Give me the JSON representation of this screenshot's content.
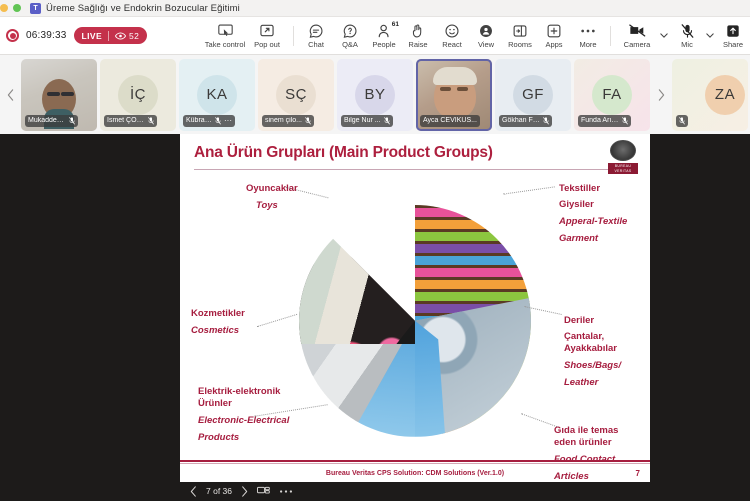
{
  "window": {
    "title": "Üreme Sağlığı ve Endokrin Bozucular Eğitimi",
    "app_icon": "teams-icon"
  },
  "meeting_bar": {
    "recording_icon": "record-icon",
    "timer": "06:39:33",
    "live_label": "LIVE",
    "viewers_icon": "eye-icon",
    "viewers_count": "52"
  },
  "toolbar": {
    "items": [
      {
        "label": "Take control",
        "icon": "take-control-icon",
        "badge": ""
      },
      {
        "label": "Pop out",
        "icon": "pop-out-icon",
        "badge": ""
      },
      {
        "label": "Chat",
        "icon": "chat-icon",
        "badge": ""
      },
      {
        "label": "Q&A",
        "icon": "qa-icon",
        "badge": ""
      },
      {
        "label": "People",
        "icon": "people-icon",
        "badge": "61"
      },
      {
        "label": "Raise",
        "icon": "raise-hand-icon",
        "badge": ""
      },
      {
        "label": "React",
        "icon": "react-smiley-icon",
        "badge": ""
      },
      {
        "label": "View",
        "icon": "view-icon",
        "badge": ""
      },
      {
        "label": "Rooms",
        "icon": "rooms-icon",
        "badge": ""
      },
      {
        "label": "Apps",
        "icon": "apps-plus-icon",
        "badge": ""
      },
      {
        "label": "More",
        "icon": "more-ellipsis-icon",
        "badge": ""
      }
    ],
    "media": [
      {
        "label": "Camera",
        "icon": "camera-off-icon",
        "has_chevron": true
      },
      {
        "label": "Mic",
        "icon": "mic-off-icon",
        "has_chevron": true
      },
      {
        "label": "Share",
        "icon": "share-tray-icon",
        "has_chevron": false
      }
    ]
  },
  "participants": {
    "prev_icon": "chevron-left-icon",
    "next_icon": "chevron-right-icon",
    "tiles": [
      {
        "name": "Mukaddes...",
        "initials": "",
        "type": "video",
        "muted": true,
        "active": false,
        "avatar_bg": "#e9e7e2",
        "more": false
      },
      {
        "name": "İsmet ÇOK...",
        "initials": "İÇ",
        "type": "avatar",
        "muted": true,
        "active": false,
        "avatar_bg": "#dcdcc9",
        "more": false
      },
      {
        "name": "Kübra ...",
        "initials": "KA",
        "type": "avatar",
        "muted": true,
        "active": false,
        "avatar_bg": "#cfe4ea",
        "more": true
      },
      {
        "name": "sinem çilo...",
        "initials": "SÇ",
        "type": "avatar",
        "muted": true,
        "active": false,
        "avatar_bg": "#eadfd2",
        "more": false
      },
      {
        "name": "Bilge Nur ...",
        "initials": "BY",
        "type": "avatar",
        "muted": true,
        "active": false,
        "avatar_bg": "#d8d7ea",
        "more": false
      },
      {
        "name": "Ayca CEVIKUS...",
        "initials": "",
        "type": "video",
        "muted": false,
        "active": true,
        "avatar_bg": "#cdb79c",
        "more": false
      },
      {
        "name": "Gökhan Fİ...",
        "initials": "GF",
        "type": "avatar",
        "muted": true,
        "active": false,
        "avatar_bg": "#d2dbe4",
        "more": false
      },
      {
        "name": "Funda Arık...",
        "initials": "FA",
        "type": "avatar",
        "muted": true,
        "active": false,
        "avatar_bg": "#d5e8cd",
        "more": false
      },
      {
        "name": "",
        "initials": "ZA",
        "type": "avatar",
        "muted": true,
        "active": false,
        "avatar_bg": "#f0cfae",
        "more": false
      }
    ]
  },
  "slide": {
    "title": "Ana Ürün Grupları (Main Product Groups)",
    "logo_name": "bureau-veritas-logo",
    "logo_word": "BUREAU VERITAS",
    "labels": [
      {
        "id": "toys",
        "tr": "Oyuncaklar",
        "en": "Toys"
      },
      {
        "id": "cosmetics",
        "tr": "Kozmetikler",
        "en": "Cosmetics"
      },
      {
        "id": "electrical",
        "tr": "Elektrik-elektronik Ürünler",
        "en": "Electronic-Electrical Products"
      },
      {
        "id": "textiles",
        "tr": "Tekstiller Giysiler",
        "en": "Apperal-Textile Garment"
      },
      {
        "id": "leather",
        "tr": "Deriler Çantalar, Ayakkabılar",
        "en": "Shoes/Bags/ Leather"
      },
      {
        "id": "food",
        "tr": "Gıda ile temas eden ürünler",
        "en": "Food Contact Articles"
      }
    ],
    "label_lines": {
      "toys_tr": "Oyuncaklar",
      "toys_en": "Toys",
      "cosmetics_tr": "Kozmetikler",
      "cosmetics_en": "Cosmetics",
      "electrical_tr1": "Elektrik-elektronik",
      "electrical_tr2": "Ürünler",
      "electrical_en1": "Electronic-Electrical",
      "electrical_en2": "Products",
      "textiles_tr1": "Tekstiller",
      "textiles_tr2": "Giysiler",
      "textiles_en1": "Apperal-Textile",
      "textiles_en2": "Garment",
      "leather_tr1": "Deriler",
      "leather_tr2": "Çantalar,",
      "leather_tr3": "Ayakkabılar",
      "leather_en1": "Shoes/Bags/",
      "leather_en2": "Leather",
      "food_tr1": "Gıda ile temas",
      "food_tr2": "eden ürünler",
      "food_en1": "Food Contact",
      "food_en2": "Articles"
    },
    "footer_text": "Bureau Veritas CPS Solution: CDM Solutions (Ver.1.0)",
    "footer_page": "7",
    "accent_color": "#a61d3f"
  },
  "bottom_nav": {
    "prev_icon": "chevron-left-icon",
    "page_indicator": "7 of 36",
    "next_icon": "chevron-right-icon",
    "layout_icon": "slide-layout-icon",
    "more_icon": "more-ellipsis-icon"
  }
}
